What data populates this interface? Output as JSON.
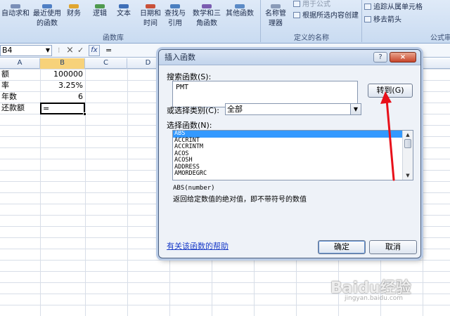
{
  "ribbon": {
    "buttons": [
      "自动求和",
      "最近使用的函数",
      "财务",
      "逻辑",
      "文本",
      "日期和时间",
      "查找与引用",
      "数学和三角函数",
      "其他函数",
      "名称管理器"
    ],
    "small_items": [
      "用于公式",
      "根据所选内容创建",
      "追踪从属单元格",
      "移去箭头"
    ],
    "groups": [
      "函数库",
      "定义的名称",
      "公式审"
    ]
  },
  "formula_bar": {
    "name_box": "B4",
    "cancel_icon": "×",
    "enter_icon": "✓",
    "fx": "fx",
    "content": "="
  },
  "sheet": {
    "columns": [
      "A",
      "B",
      "C",
      "D"
    ],
    "cells": {
      "a1": "额",
      "b1": "100000",
      "a2": "率",
      "b2": "3.25%",
      "a3": "年数",
      "b3": "6",
      "a4": "还款额",
      "b4": "="
    }
  },
  "dialog": {
    "title": "插入函数",
    "help": "?",
    "close": "×",
    "search_label": "搜索函数(S):",
    "search_value": "PMT",
    "goto_button": "转到(G)",
    "category_label": "或选择类别(C):",
    "category_value": "全部",
    "select_label": "选择函数(N):",
    "functions": [
      "ABS",
      "ACCRINT",
      "ACCRINTM",
      "ACOS",
      "ACOSH",
      "ADDRESS",
      "AMORDEGRC"
    ],
    "selected_function": "ABS",
    "signature": "ABS(number)",
    "description": "返回给定数值的绝对值，即不带符号的数值",
    "help_link": "有关该函数的帮助",
    "ok": "确定",
    "cancel": "取消"
  },
  "annotation": {
    "arrow_color": "#e8101a"
  },
  "watermark": {
    "logo": "Baidu经验",
    "url": "jingyan.baidu.com"
  }
}
